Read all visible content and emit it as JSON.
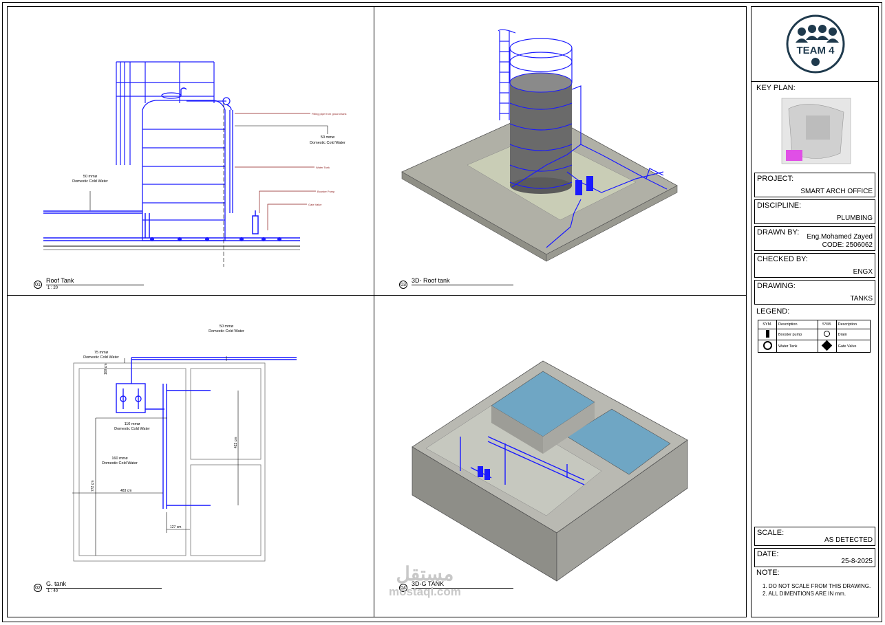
{
  "views": [
    {
      "num": "01",
      "title": "Roof Tank",
      "scale": "1 : 20"
    },
    {
      "num": "03",
      "title": "3D- Roof tank",
      "scale": ""
    },
    {
      "num": "02",
      "title": "G. tank",
      "scale": "1 : 40"
    },
    {
      "num": "04",
      "title": "3D-G TANK",
      "scale": ""
    }
  ],
  "roof_tank": {
    "label_50mm_left": "50 mmø",
    "label_dcw_left": "Domestic Cold Water",
    "label_50mm_right": "50 mmø",
    "label_dcw_right": "Domestic Cold Water",
    "callout_filling": "Filling pipe from ground tank",
    "callout_water_tank": "Water Tank",
    "callout_booster": "Booster Pump",
    "callout_gate": "Gate Valve"
  },
  "g_tank": {
    "label_50mm": "50 mmø",
    "label_50mm_dcw": "Domestic Cold Water",
    "label_75mm": "75 mmø",
    "label_75mm_dcw": "Domestic Cold Water",
    "label_110mm": "110 mmø",
    "label_110mm_dcw": "Domestic Cold Water",
    "label_160mm": "160 mmø",
    "label_160mm_dcw": "Domestic Cold Water",
    "dim_100": "100 cm",
    "dim_422": "422 cm",
    "dim_772": "772 cm",
    "dim_483": "483 cm",
    "dim_127": "127 cm"
  },
  "titleblock": {
    "logo_text": "TEAM 4",
    "key_plan_label": "KEY PLAN:",
    "project_label": "PROJECT:",
    "project_value": "SMART ARCH OFFICE",
    "discipline_label": "DISCIPLINE:",
    "discipline_value": "PLUMBING",
    "drawn_label": "DRAWN BY:",
    "drawn_value": "Eng.Mohamed Zayed",
    "drawn_code": "CODE: 2506062",
    "checked_label": "CHECKED BY:",
    "checked_value": "ENGX",
    "drawing_label": "DRAWING:",
    "drawing_value": "TANKS",
    "legend_label": "LEGEND:",
    "legend_headers": [
      "SYM.",
      "Description",
      "SYM.",
      "Description"
    ],
    "legend_rows": [
      [
        "Booster pump",
        "Drain"
      ],
      [
        "Water Tank",
        "Gate Valve"
      ]
    ],
    "scale_label": "SCALE:",
    "scale_value": "AS DETECTED",
    "date_label": "DATE:",
    "date_value": "25-8-2025",
    "note_label": "NOTE:",
    "notes": [
      "1. DO NOT SCALE FROM THIS DRAWING.",
      "2. ALL DIMENTIONS ARE IN mm."
    ]
  },
  "watermark": {
    "arabic": "مستقل",
    "latin": "mostaql.com"
  },
  "colors": {
    "pipe": "#1a1aff",
    "callout": "#8b1a1a",
    "concrete": "#a9a9a0",
    "water": "#6fa6c4"
  }
}
